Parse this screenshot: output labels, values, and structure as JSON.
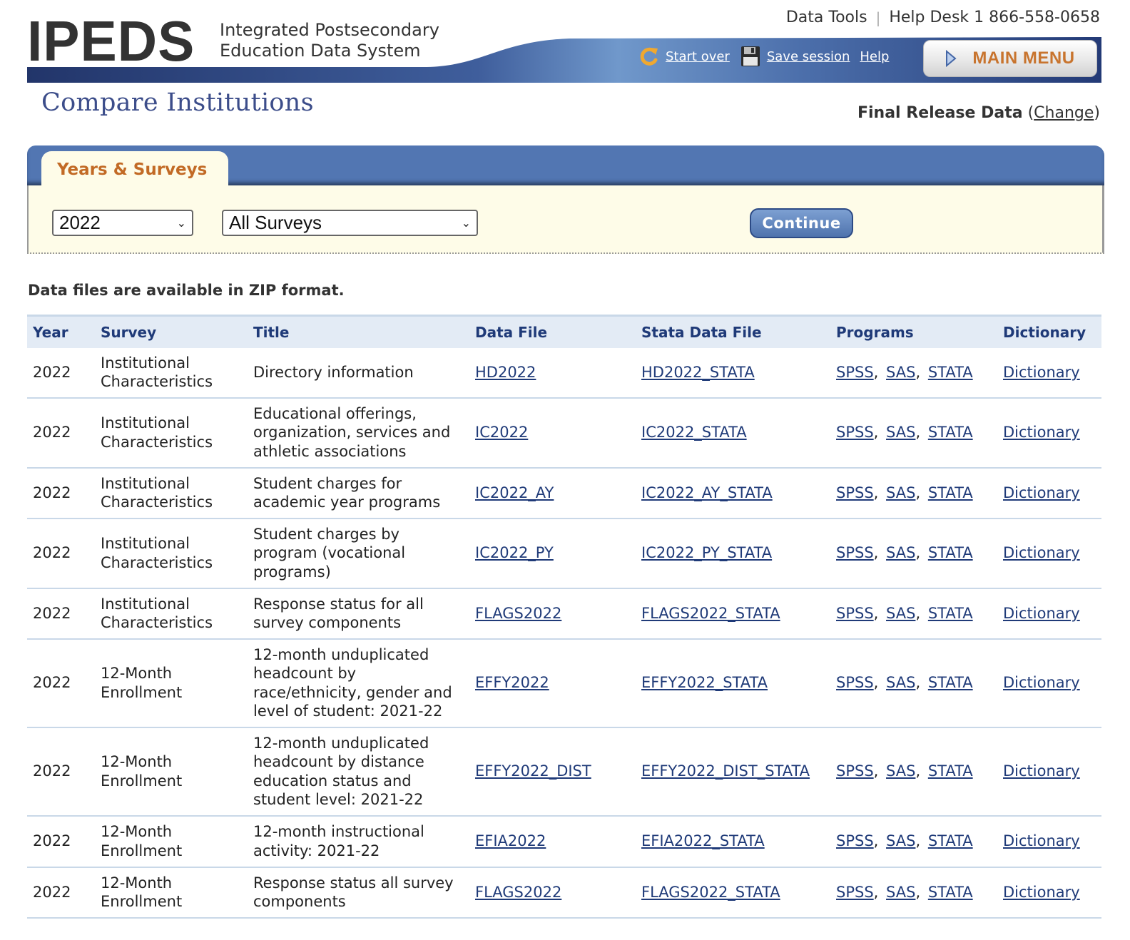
{
  "header": {
    "logo": "IPEDS",
    "logo_sub_line1": "Integrated Postsecondary",
    "logo_sub_line2": "Education Data System",
    "top_links": {
      "data_tools": "Data Tools",
      "separator": "|",
      "help_desk": "Help Desk 1 866-558-0658"
    },
    "tools": {
      "start_over": "Start over",
      "save_session": "Save session",
      "help": "Help"
    },
    "main_menu": "MAIN MENU",
    "icons": {
      "start_over": "refresh-icon",
      "save_session": "floppy-disk-icon",
      "main_menu": "triangle-right-icon"
    }
  },
  "page": {
    "title": "Compare Institutions",
    "release_label": "Final Release Data",
    "release_open": "(",
    "release_change": "Change",
    "release_close": ")"
  },
  "panel": {
    "tab_label": "Years & Surveys",
    "year_select": {
      "value": "2022"
    },
    "survey_select": {
      "value": "All Surveys"
    },
    "continue_label": "Continue"
  },
  "zip_note": "Data files are available in ZIP format.",
  "table": {
    "columns": [
      "Year",
      "Survey",
      "Title",
      "Data File",
      "Stata Data File",
      "Programs",
      "Dictionary"
    ],
    "program_links": [
      "SPSS",
      "SAS",
      "STATA"
    ],
    "rows": [
      {
        "year": "2022",
        "survey": "Institutional Characteristics",
        "title": "Directory information",
        "data_file": "HD2022",
        "stata_file": "HD2022_STATA",
        "dictionary": "Dictionary"
      },
      {
        "year": "2022",
        "survey": "Institutional Characteristics",
        "title": "Educational offerings, organization, services and athletic associations",
        "data_file": "IC2022",
        "stata_file": "IC2022_STATA",
        "dictionary": "Dictionary"
      },
      {
        "year": "2022",
        "survey": "Institutional Characteristics",
        "title": "Student charges for academic year programs",
        "data_file": "IC2022_AY",
        "stata_file": "IC2022_AY_STATA",
        "dictionary": "Dictionary"
      },
      {
        "year": "2022",
        "survey": "Institutional Characteristics",
        "title": "Student charges by program (vocational programs)",
        "data_file": "IC2022_PY",
        "stata_file": "IC2022_PY_STATA",
        "dictionary": "Dictionary"
      },
      {
        "year": "2022",
        "survey": "Institutional Characteristics",
        "title": "Response status for all survey components",
        "data_file": "FLAGS2022",
        "stata_file": "FLAGS2022_STATA",
        "dictionary": "Dictionary"
      },
      {
        "year": "2022",
        "survey": "12-Month Enrollment",
        "title": "12-month unduplicated headcount by race/ethnicity, gender and level of student: 2021-22",
        "data_file": "EFFY2022",
        "stata_file": "EFFY2022_STATA",
        "dictionary": "Dictionary"
      },
      {
        "year": "2022",
        "survey": "12-Month Enrollment",
        "title": "12-month unduplicated headcount by distance education status and student level: 2021-22",
        "data_file": "EFFY2022_DIST",
        "stata_file": "EFFY2022_DIST_STATA",
        "dictionary": "Dictionary"
      },
      {
        "year": "2022",
        "survey": "12-Month Enrollment",
        "title": "12-month instructional activity: 2021-22",
        "data_file": "EFIA2022",
        "stata_file": "EFIA2022_STATA",
        "dictionary": "Dictionary"
      },
      {
        "year": "2022",
        "survey": "12-Month Enrollment",
        "title": "Response status all survey components",
        "data_file": "FLAGS2022",
        "stata_file": "FLAGS2022_STATA",
        "dictionary": "Dictionary"
      }
    ]
  },
  "colors": {
    "brand_blue": "#5276b2",
    "link": "#1f3a78",
    "tab_text": "#c26a25",
    "panel_bg": "#fefce8",
    "header_row_bg": "#e3ebf5"
  }
}
